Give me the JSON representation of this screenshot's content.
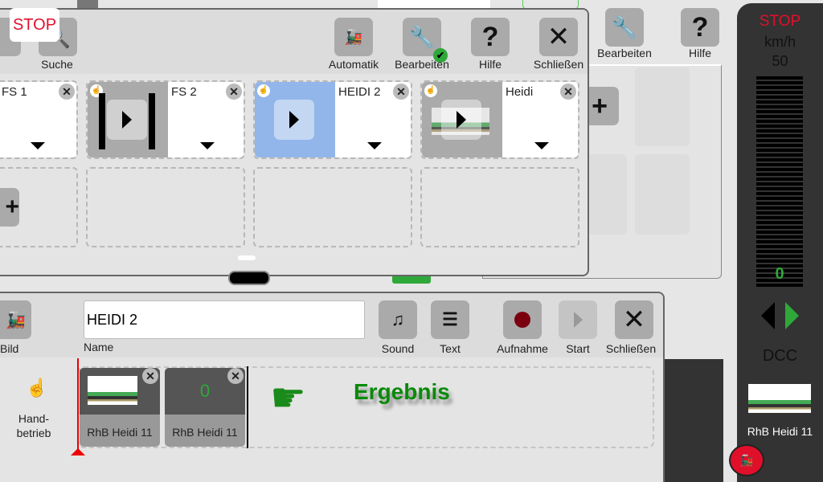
{
  "background_panel": {
    "edit_label": "Bearbeiten",
    "help_label": "Hilfe"
  },
  "popup": {
    "stop_label": "STOP",
    "toolbar": [
      {
        "label": "Suche",
        "icon": "search-icon"
      },
      {
        "label": "Automatik",
        "icon": "locomotive-plus-icon"
      },
      {
        "label": "Bearbeiten",
        "icon": "wrench-icon"
      },
      {
        "label": "Hilfe",
        "icon": "question-icon"
      },
      {
        "label": "Schließen",
        "icon": "close-icon"
      }
    ],
    "tiles": [
      {
        "name": "FS 1"
      },
      {
        "name": "FS 2"
      },
      {
        "name": "HEIDI 2"
      },
      {
        "name": "Heidi"
      }
    ]
  },
  "editor": {
    "image_label": "Bild",
    "name_value": "HEIDI 2",
    "name_label": "Name",
    "sound_label": "Sound",
    "text_label": "Text",
    "record_label": "Aufnahme",
    "start_label": "Start",
    "close_label": "Schließen",
    "mode_label_1": "Hand-",
    "mode_label_2": "betrieb",
    "steps": [
      {
        "label": "RhB Heidi 11",
        "value": ""
      },
      {
        "label": "RhB Heidi 11",
        "value": "0"
      }
    ],
    "result_label": "Ergebnis"
  },
  "control": {
    "stop_label": "STOP",
    "unit": "km/h",
    "max_speed": "50",
    "speed": "0",
    "protocol": "DCC",
    "loco_name": "RhB Heidi 11",
    "colors": {
      "stop": "#e0102a",
      "active": "#2fa83a"
    }
  }
}
